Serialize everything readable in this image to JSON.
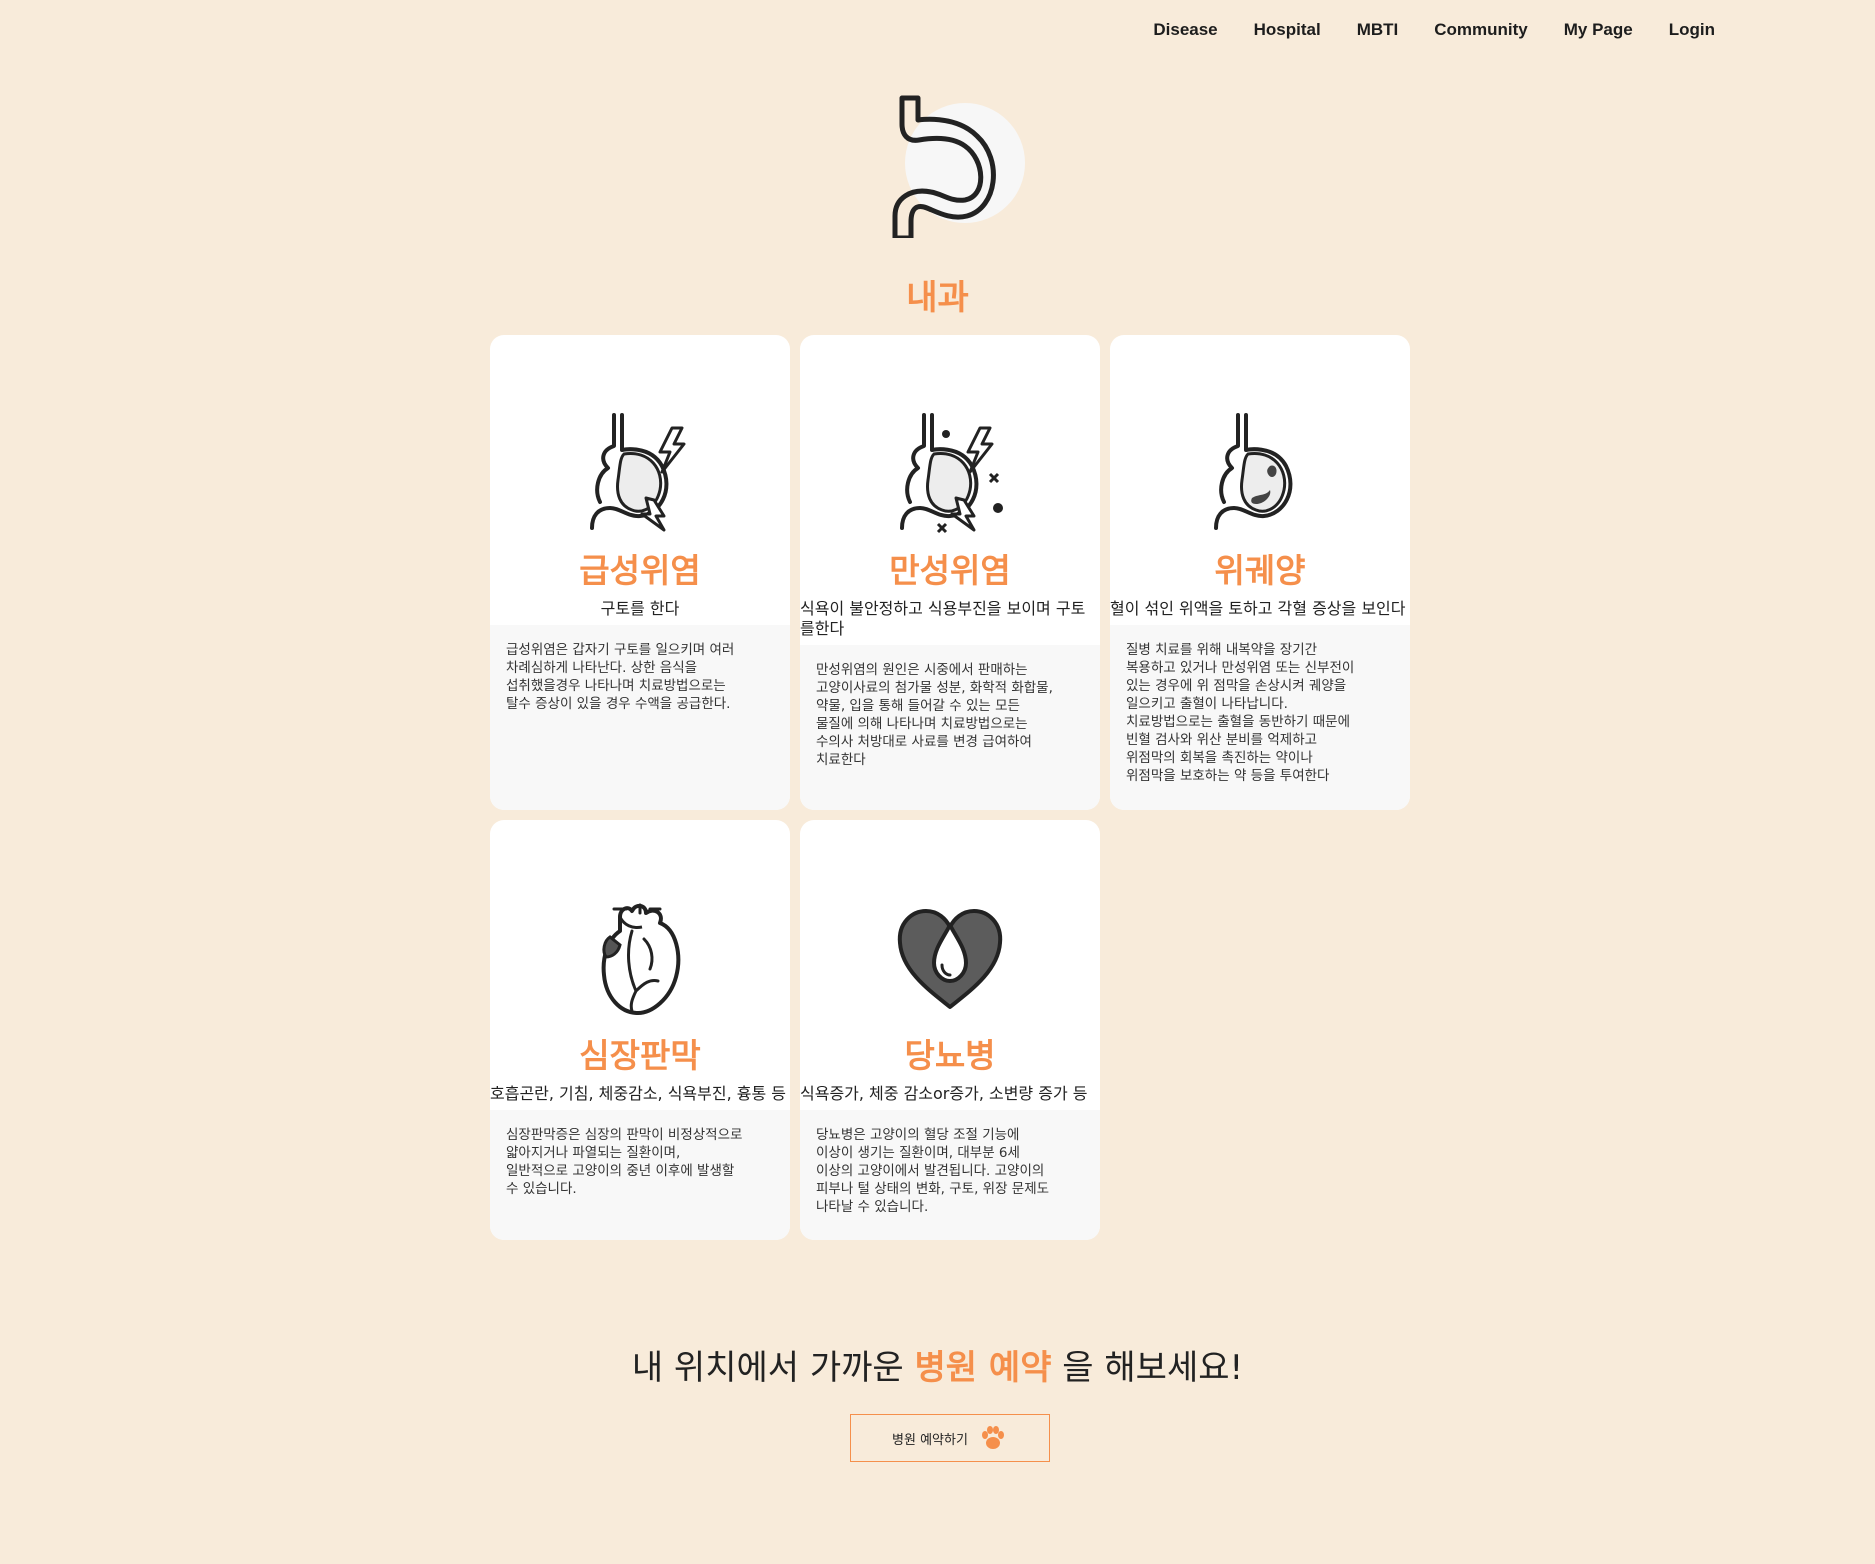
{
  "nav": {
    "items": [
      {
        "label": "Disease"
      },
      {
        "label": "Hospital"
      },
      {
        "label": "MBTI"
      },
      {
        "label": "Community"
      },
      {
        "label": "My Page"
      },
      {
        "label": "Login"
      }
    ]
  },
  "hero": {
    "icon": "stomach-icon",
    "title": "내과"
  },
  "diseases": [
    {
      "icon": "stomach-pain-icon",
      "name": "급성위염",
      "symptom": "구토를 한다",
      "description": "급성위염은 갑자기 구토를 일으키며 여러\n차례심하게 나타난다. 상한 음식을\n섭취했을경우 나타나며 치료방법으로는\n탈수 증상이 있을 경우 수액을 공급한다."
    },
    {
      "icon": "stomach-chronic-icon",
      "name": "만성위염",
      "symptom": "식욕이 불안정하고 식용부진을 보이며 구토를한다",
      "description": "만성위염의 원인은 시중에서 판매하는\n고양이사료의 첨가물 성분, 화학적 화합물,\n약물, 입을 통해 들어갈 수 있는 모든\n물질에 의해 나타나며 치료방법으로는\n수의사 처방대로 사료를 변경 급여하여\n치료한다"
    },
    {
      "icon": "stomach-ulcer-icon",
      "name": "위궤양",
      "symptom": "혈이 섞인 위액을 토하고 각혈 증상을 보인다",
      "description": "질병 치료를 위해 내복약을 장기간\n복용하고 있거나 만성위염 또는 신부전이\n있는 경우에 위 점막을 손상시켜 궤양을\n일으키고 출혈이 나타납니다.\n치료방법으로는 출혈을 동반하기 때문에\n빈혈 검사와 위산 분비를 억제하고\n위점막의 회복을 촉진하는 약이나\n위점막을 보호하는 약 등을 투여한다"
    },
    {
      "icon": "heart-organ-icon",
      "name": "심장판막",
      "symptom": "호흡곤란, 기침, 체중감소, 식욕부진, 흉통 등",
      "description": "심장판막증은 심장의 판막이 비정상적으로\n얇아지거나 파열되는 질환이며,\n일반적으로 고양이의 중년 이후에 발생할\n수 있습니다."
    },
    {
      "icon": "heart-drop-icon",
      "name": "당뇨병",
      "symptom": "식욕증가, 체중 감소or증가, 소변량 증가 등",
      "description": "당뇨병은 고양이의 혈당 조절 기능에\n이상이 생기는 질환이며, 대부분 6세\n이상의 고양이에서 발견됩니다. 고양이의\n피부나 털 상태의 변화, 구토, 위장 문제도\n나타날 수 있습니다."
    }
  ],
  "cta": {
    "prefix": "내 위치에서 가까운 ",
    "highlight": "병원 예약",
    "suffix": " 을 해보세요!",
    "button_label": "병원 예약하기",
    "button_icon": "paw-icon"
  },
  "colors": {
    "background": "#f8ebda",
    "accent": "#f58f4b"
  }
}
